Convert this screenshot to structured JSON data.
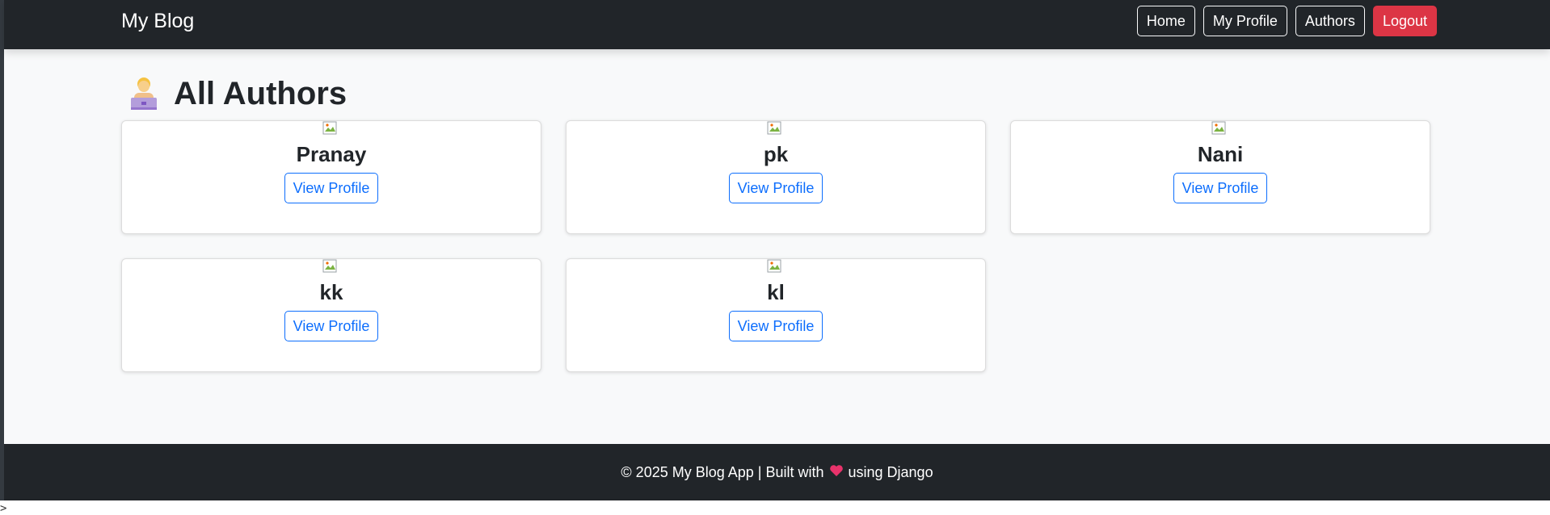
{
  "navbar": {
    "brand": "My Blog",
    "links": [
      {
        "label": "Home"
      },
      {
        "label": "My Profile"
      },
      {
        "label": "Authors"
      },
      {
        "label": "Logout"
      }
    ]
  },
  "main": {
    "title": "All Authors",
    "title_icon": "technologist-emoji-icon",
    "authors": [
      {
        "name": "Pranay",
        "button": "View Profile"
      },
      {
        "name": "pk",
        "button": "View Profile"
      },
      {
        "name": "Nani",
        "button": "View Profile"
      },
      {
        "name": "kk",
        "button": "View Profile"
      },
      {
        "name": "kl",
        "button": "View Profile"
      }
    ]
  },
  "footer": {
    "text_before": "© 2025 My Blog App | Built with",
    "heart_icon": "heart-icon",
    "text_after": "using Django"
  },
  "colors": {
    "navbar_bg": "#212529",
    "page_bg": "#f8f9fa",
    "logout_bg": "#dc3545",
    "primary": "#0d6efd",
    "heart": "#e8336b"
  }
}
